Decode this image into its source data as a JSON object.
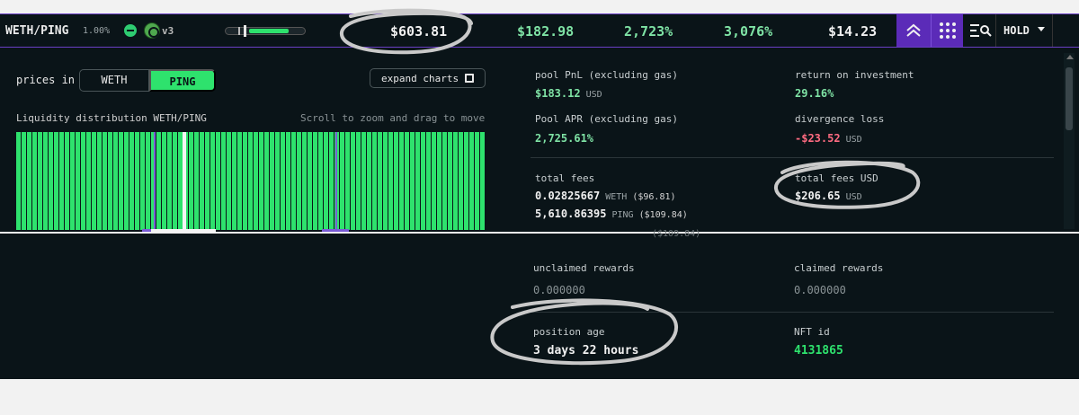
{
  "header": {
    "pair": "WETH/PING",
    "fee": "1.00%",
    "version": "v3",
    "price": "$603.81",
    "stat_1": "$182.98",
    "stat_2": "2,723%",
    "stat_3": "3,076%",
    "stat_4": "$14.23",
    "hold_label": "HOLD"
  },
  "controls": {
    "prices_in_label": "prices in",
    "token_a": "WETH",
    "token_b": "PING",
    "selected_token": "PING",
    "expand_label": "expand charts"
  },
  "liquidity": {
    "title": "Liquidity distribution WETH/PING",
    "hint": "Scroll to zoom and drag to move"
  },
  "stats": {
    "pool_pnl_label": "pool PnL (excluding gas)",
    "pool_pnl_value": "$183.12",
    "pool_pnl_unit": "USD",
    "roi_label": "return on investment",
    "roi_value": "29.16%",
    "apr_label": "Pool APR (excluding gas)",
    "apr_value": "2,725.61%",
    "divergence_label": "divergence loss",
    "divergence_value": "-$23.52",
    "divergence_unit": "USD",
    "total_fees_label": "total fees",
    "fees_weth_value": "0.02825667",
    "fees_weth_unit": "WETH",
    "fees_weth_usd": "($96.81)",
    "fees_ping_value": "5,610.86395",
    "fees_ping_unit": "PING",
    "fees_ping_usd": "($109.84)",
    "total_fees_usd_label": "total fees USD",
    "total_fees_usd_value": "$206.65",
    "total_fees_usd_unit": "USD",
    "partial_line": "($109.84)"
  },
  "rewards": {
    "unclaimed_label": "unclaimed rewards",
    "unclaimed_value": "0.000000",
    "claimed_label": "claimed rewards",
    "claimed_value": "0.000000",
    "age_label": "position age",
    "age_value": "3 days 22 hours",
    "nft_label": "NFT id",
    "nft_value": "4131865"
  },
  "colors": {
    "accent_green": "#2ee26d",
    "accent_purple": "#5b2bb8",
    "negative_red": "#ff6b81",
    "background": "#0a1418"
  },
  "icons": [
    "toggle-icon",
    "chameleon-icon",
    "chevrons-up-icon",
    "grid-icon",
    "search-list-icon",
    "chevron-down-icon",
    "expand-icon"
  ]
}
